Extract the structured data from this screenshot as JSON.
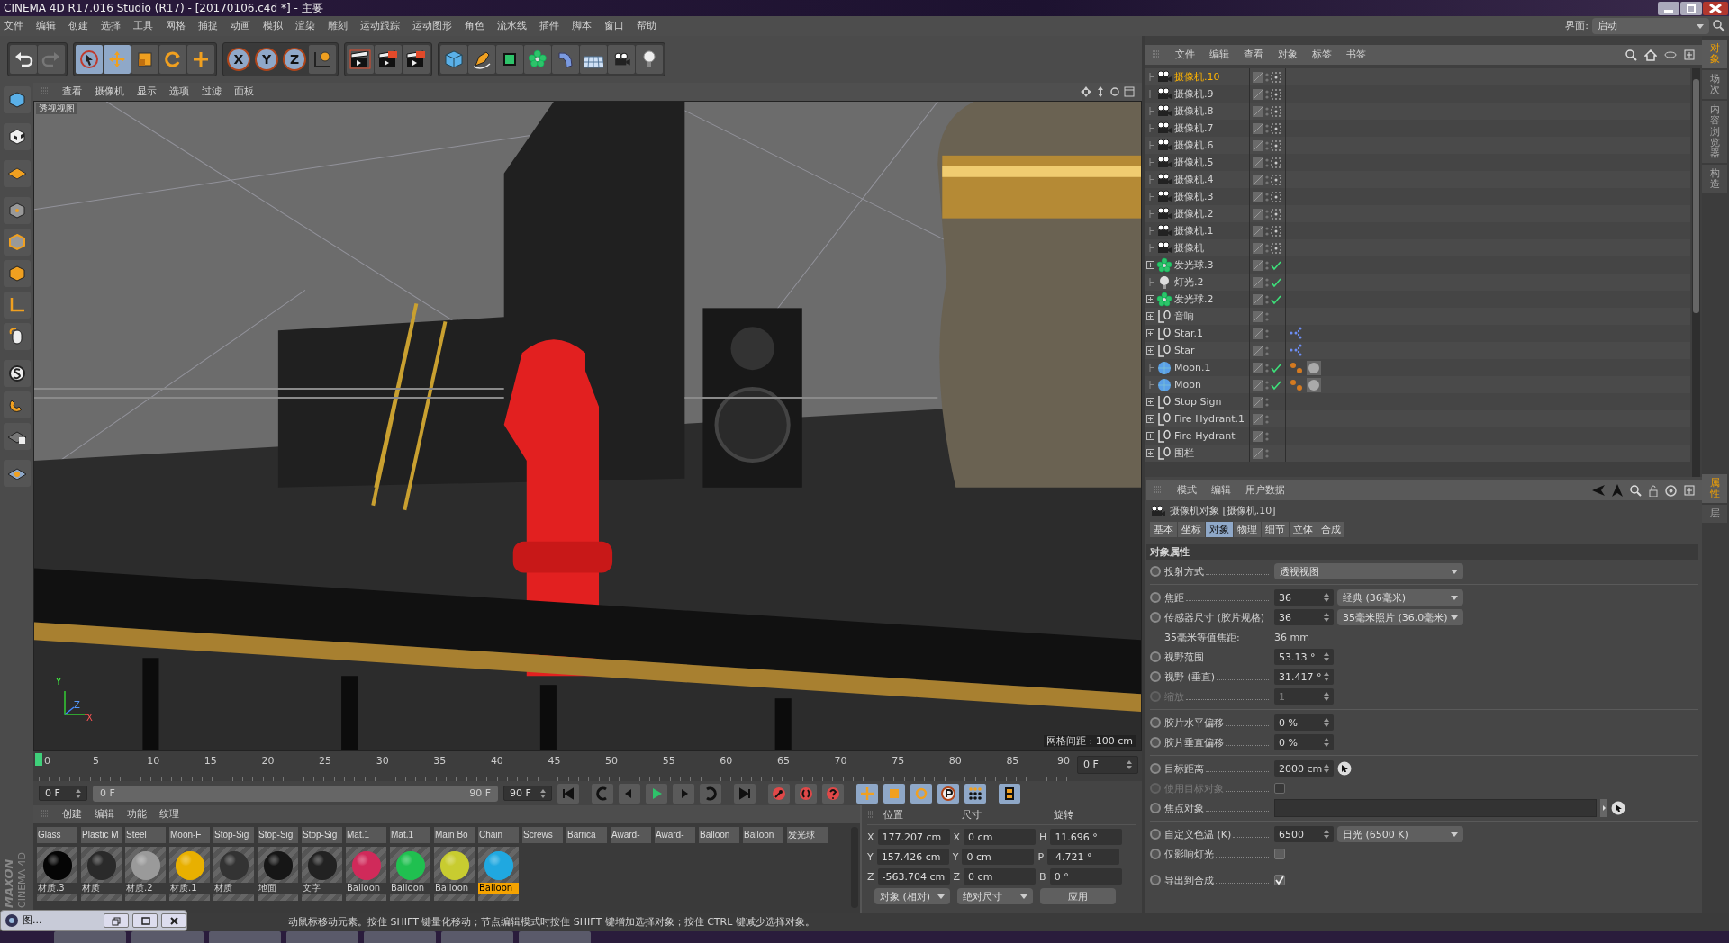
{
  "window": {
    "title": "CINEMA 4D R17.016 Studio (R17) - [20170106.c4d *] - 主要"
  },
  "menu": [
    "文件",
    "编辑",
    "创建",
    "选择",
    "工具",
    "网格",
    "捕捉",
    "动画",
    "模拟",
    "渲染",
    "雕刻",
    "运动跟踪",
    "运动图形",
    "角色",
    "流水线",
    "插件",
    "脚本",
    "窗口",
    "帮助"
  ],
  "layout_switcher": {
    "label": "界面:",
    "value": "启动"
  },
  "toolbar": {
    "tools": [
      {
        "kind": "select",
        "selected": true
      },
      {
        "kind": "move",
        "selected": true
      },
      {
        "kind": "scale",
        "selected": false
      },
      {
        "kind": "rotate",
        "selected": false
      },
      {
        "kind": "transform",
        "selected": false
      }
    ],
    "axis_buttons": [
      {
        "label": "X",
        "selected": true
      },
      {
        "label": "Y",
        "selected": true
      },
      {
        "label": "Z",
        "selected": true
      }
    ]
  },
  "viewport": {
    "menu": [
      "查看",
      "摄像机",
      "显示",
      "选项",
      "过滤",
      "面板"
    ],
    "view_name": "透视视图",
    "grid_spacing": "网格间距 : 100 cm",
    "axis_labels": [
      "Y",
      "Z",
      "X"
    ]
  },
  "timeline": {
    "ticks": [
      "0",
      "5",
      "10",
      "15",
      "20",
      "25",
      "30",
      "35",
      "40",
      "45",
      "50",
      "55",
      "60",
      "65",
      "70",
      "75",
      "80",
      "85",
      "90"
    ],
    "level": 0,
    "current": "0 F",
    "start": "0 F",
    "slider_start": "0 F",
    "slider_end": "90 F",
    "end": "90 F"
  },
  "materials": {
    "menu": [
      "创建",
      "编辑",
      "功能",
      "纹理"
    ],
    "row_labels": [
      "Glass",
      "Plastic M",
      "Steel",
      "Moon-F",
      "Stop-Sig",
      "Stop-Sig",
      "Stop-Sig",
      "Mat.1",
      "Mat.1",
      "Main Bo",
      "Chain",
      "Screws",
      "Barrica",
      "Award-",
      "Award-",
      "Balloon",
      "Balloon",
      "发光球"
    ],
    "items": [
      {
        "name": "材质.3",
        "color": "#050505",
        "selected": false
      },
      {
        "name": "材质",
        "color": "#2a2a2a",
        "selected": false
      },
      {
        "name": "材质.2",
        "color": "#9a9a9a",
        "selected": false
      },
      {
        "name": "材质.1",
        "color": "#e8b000",
        "selected": false
      },
      {
        "name": "材质",
        "color": "#333333",
        "selected": false
      },
      {
        "name": "地面",
        "color": "#161616",
        "selected": false
      },
      {
        "name": "文字",
        "color": "#222222",
        "selected": false
      },
      {
        "name": "Balloon",
        "color": "#d02a5a",
        "selected": false
      },
      {
        "name": "Balloon",
        "color": "#20c050",
        "selected": false
      },
      {
        "name": "Balloon",
        "color": "#c8cc30",
        "selected": false
      },
      {
        "name": "Balloon",
        "color": "#20a8e0",
        "selected": true
      }
    ]
  },
  "coords": {
    "headers": [
      "位置",
      "尺寸",
      "旋转"
    ],
    "rows": [
      {
        "axis": "X",
        "position": "177.207 cm",
        "size_axis": "X",
        "size": "0 cm",
        "rot_axis": "H",
        "rotation": "11.696 °"
      },
      {
        "axis": "Y",
        "position": "157.426 cm",
        "size_axis": "Y",
        "size": "0 cm",
        "rot_axis": "P",
        "rotation": "-4.721 °"
      },
      {
        "axis": "Z",
        "position": "-563.704 cm",
        "size_axis": "Z",
        "size": "0 cm",
        "rot_axis": "B",
        "rotation": "0 °"
      }
    ],
    "mode": "对象 (相对)",
    "size_mode": "绝对尺寸",
    "apply": "应用"
  },
  "objects": {
    "menu": [
      "文件",
      "编辑",
      "查看",
      "对象",
      "标签",
      "书签"
    ],
    "items": [
      {
        "name": "摄像机.10",
        "kind": "camera",
        "expandable": false,
        "selected": true,
        "checked": false
      },
      {
        "name": "摄像机.9",
        "kind": "camera",
        "expandable": false,
        "selected": false,
        "checked": false
      },
      {
        "name": "摄像机.8",
        "kind": "camera",
        "expandable": false,
        "selected": false,
        "checked": false
      },
      {
        "name": "摄像机.7",
        "kind": "camera",
        "expandable": false,
        "selected": false,
        "checked": false
      },
      {
        "name": "摄像机.6",
        "kind": "camera",
        "expandable": false,
        "selected": false,
        "checked": false
      },
      {
        "name": "摄像机.5",
        "kind": "camera",
        "expandable": false,
        "selected": false,
        "checked": false
      },
      {
        "name": "摄像机.4",
        "kind": "camera",
        "expandable": false,
        "selected": false,
        "checked": false
      },
      {
        "name": "摄像机.3",
        "kind": "camera",
        "expandable": false,
        "selected": false,
        "checked": false
      },
      {
        "name": "摄像机.2",
        "kind": "camera",
        "expandable": false,
        "selected": false,
        "checked": false
      },
      {
        "name": "摄像机.1",
        "kind": "camera",
        "expandable": false,
        "selected": false,
        "checked": false
      },
      {
        "name": "摄像机",
        "kind": "camera",
        "expandable": false,
        "selected": false,
        "checked": false
      },
      {
        "name": "发光球.3",
        "kind": "cloner",
        "expandable": true,
        "selected": false,
        "checked": true
      },
      {
        "name": "灯光.2",
        "kind": "light",
        "expandable": false,
        "selected": false,
        "checked": true
      },
      {
        "name": "发光球.2",
        "kind": "cloner",
        "expandable": true,
        "selected": false,
        "checked": true
      },
      {
        "name": "音响",
        "kind": "null",
        "expandable": true,
        "selected": false,
        "checked": false
      },
      {
        "name": "Star.1",
        "kind": "null",
        "expandable": true,
        "selected": false,
        "checked": false,
        "tags": [
          {
            "kind": "align"
          }
        ]
      },
      {
        "name": "Star",
        "kind": "null",
        "expandable": true,
        "selected": false,
        "checked": false,
        "tags": [
          {
            "kind": "align"
          }
        ]
      },
      {
        "name": "Moon.1",
        "kind": "sphere",
        "expandable": false,
        "selected": false,
        "checked": true,
        "tags": [
          {
            "kind": "points"
          },
          {
            "kind": "material"
          }
        ]
      },
      {
        "name": "Moon",
        "kind": "sphere",
        "expandable": false,
        "selected": false,
        "checked": true,
        "tags": [
          {
            "kind": "points"
          },
          {
            "kind": "material"
          }
        ]
      },
      {
        "name": "Stop Sign",
        "kind": "null",
        "expandable": true,
        "selected": false,
        "checked": false
      },
      {
        "name": "Fire Hydrant.1",
        "kind": "null",
        "expandable": true,
        "selected": false,
        "checked": false
      },
      {
        "name": "Fire Hydrant",
        "kind": "null",
        "expandable": true,
        "selected": false,
        "checked": false
      },
      {
        "name": "围栏",
        "kind": "null",
        "expandable": true,
        "selected": false,
        "checked": false
      }
    ]
  },
  "attributes": {
    "menu": [
      "模式",
      "编辑",
      "用户数据"
    ],
    "title": "摄像机对象 [摄像机.10]",
    "tabs": [
      {
        "label": "基本",
        "selected": false
      },
      {
        "label": "坐标",
        "selected": false
      },
      {
        "label": "对象",
        "selected": true
      },
      {
        "label": "物理",
        "selected": false
      },
      {
        "label": "细节",
        "selected": false
      },
      {
        "label": "立体",
        "selected": false
      },
      {
        "label": "合成",
        "selected": false
      }
    ],
    "section": "对象属性",
    "groups": [
      [
        {
          "label": "投射方式",
          "kind": "select",
          "option": "透视视图",
          "disabled": false
        }
      ],
      [
        {
          "label": "焦距",
          "kind": "number_select",
          "value": "36",
          "option": "经典 (36毫米)",
          "disabled": false
        },
        {
          "label": "传感器尺寸 (胶片规格)",
          "kind": "number_select",
          "value": "36",
          "option": "35毫米照片 (36.0毫米)",
          "disabled": false
        },
        {
          "label": "35毫米等值焦距:",
          "kind": "info",
          "value": "36 mm",
          "disabled": false
        },
        {
          "label": "视野范围",
          "kind": "number",
          "value": "53.13 °",
          "disabled": false
        },
        {
          "label": "视野 (垂直)",
          "kind": "number",
          "value": "31.417 °",
          "disabled": false
        },
        {
          "label": "缩放",
          "kind": "number",
          "value": "1",
          "disabled": true
        }
      ],
      [
        {
          "label": "胶片水平偏移",
          "kind": "number",
          "value": "0 %",
          "disabled": false
        },
        {
          "label": "胶片垂直偏移",
          "kind": "number",
          "value": "0 %",
          "disabled": false
        }
      ],
      [
        {
          "label": "目标距离",
          "kind": "number_pick",
          "value": "2000 cm",
          "disabled": false
        },
        {
          "label": "使用目标对象",
          "kind": "checkbox",
          "checked": false,
          "disabled": true
        },
        {
          "label": "焦点对象",
          "kind": "link",
          "disabled": false
        }
      ],
      [
        {
          "label": "自定义色温 (K)",
          "kind": "number_select",
          "value": "6500",
          "option": "日光 (6500 K)",
          "disabled": false
        },
        {
          "label": "仅影响灯光",
          "kind": "checkbox",
          "checked": false,
          "disabled": false
        }
      ],
      [
        {
          "label": "导出到合成",
          "kind": "checkbox",
          "checked": true,
          "disabled": false
        }
      ]
    ]
  },
  "side_tabs_top": [
    {
      "label": "对象",
      "selected": true
    },
    {
      "label": "场次",
      "selected": false
    },
    {
      "label": "内容浏览器",
      "selected": false
    },
    {
      "label": "构造",
      "selected": false
    }
  ],
  "side_tabs_bottom": [
    {
      "label": "属性",
      "selected": true
    },
    {
      "label": "层",
      "selected": false
    }
  ],
  "logo": [
    "MAXON",
    "CINEMA 4D"
  ],
  "minimized_window": {
    "title": "图..."
  },
  "status": "动鼠标移动元素。按住 SHIFT 键量化移动；节点编辑模式时按住 SHIFT 键增加选择对象；按住 CTRL 键减少选择对象。"
}
